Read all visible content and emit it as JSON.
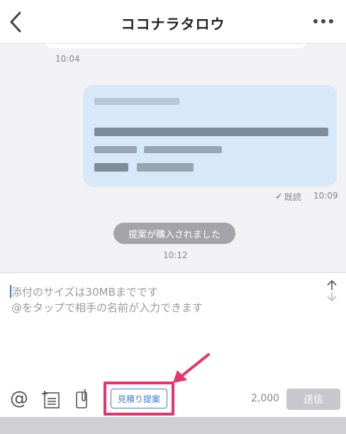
{
  "header": {
    "title": "ココナラタロウ"
  },
  "chat": {
    "messages": [
      {
        "time": "10:04"
      },
      {
        "status": "既読",
        "time": "10:09"
      }
    ],
    "system_message": "提案が購入されました",
    "system_time": "10:12"
  },
  "composer": {
    "placeholder": "添付のサイズは30MBまでです\n@をタップで相手の名前が入力できます",
    "estimate_button": "見積り提案",
    "char_count": "2,000",
    "send_button": "送信"
  },
  "icons": [
    "back-chevron-icon",
    "more-dots-icon",
    "expand-arrows-icon",
    "mention-at-icon",
    "template-list-icon",
    "attachment-clip-icon",
    "annotation-arrow-icon"
  ],
  "colors": {
    "accent": "#3a7bd5",
    "highlight": "#e8336b",
    "bubble": "#d7e8f8"
  }
}
